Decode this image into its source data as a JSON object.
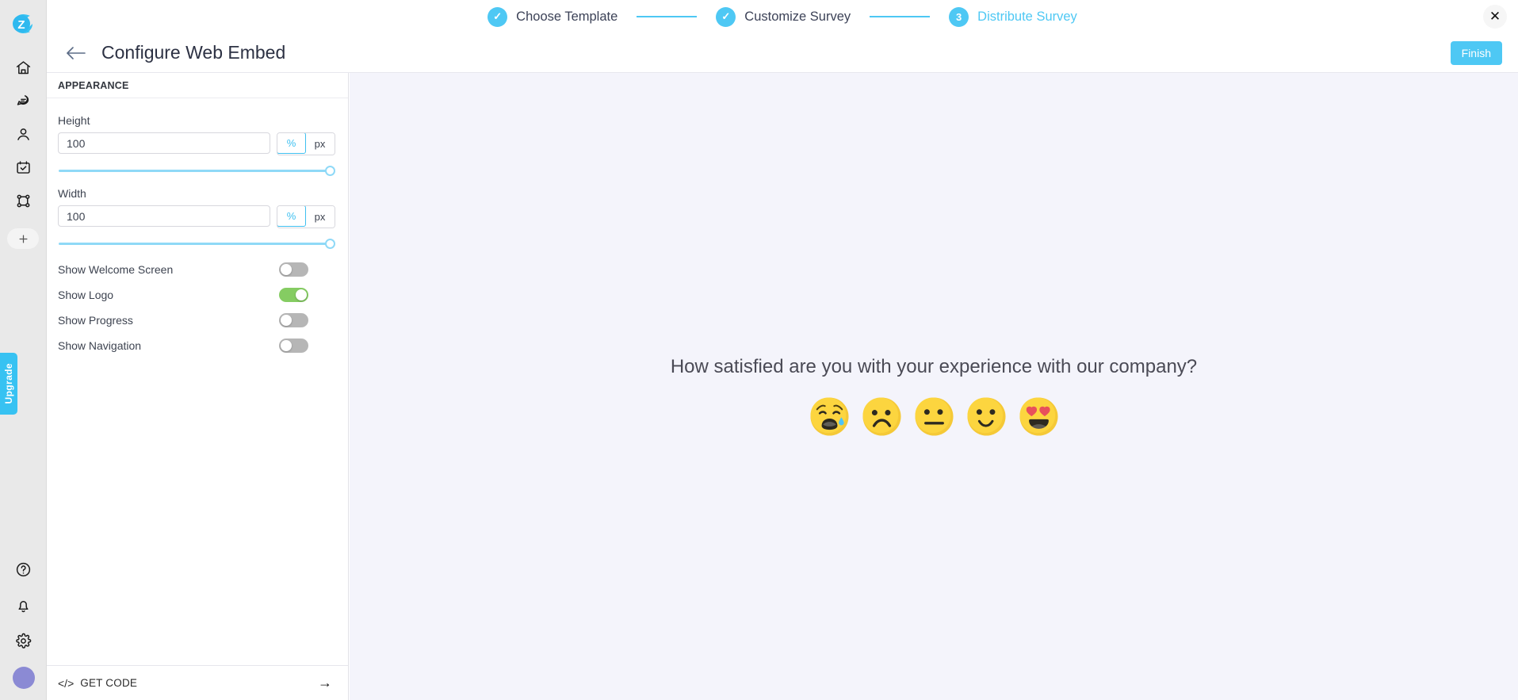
{
  "brand": {
    "accent": "#4ec8f4",
    "toggle_on": "#85cc62",
    "logo_letter": "Z",
    "upgrade_label": "Upgrade"
  },
  "sidebar": {
    "items": [
      {
        "name": "home-icon",
        "label": "Home"
      },
      {
        "name": "feedback-icon",
        "label": "Feedback"
      },
      {
        "name": "contacts-icon",
        "label": "Contacts"
      },
      {
        "name": "tasks-icon",
        "label": "Tasks"
      },
      {
        "name": "workflows-icon",
        "label": "Workflows"
      }
    ],
    "add_label": "+",
    "bottom_items": [
      {
        "name": "help-icon",
        "label": "Help"
      },
      {
        "name": "notifications-icon",
        "label": "Notifications"
      },
      {
        "name": "settings-icon",
        "label": "Settings"
      }
    ]
  },
  "stepper": {
    "steps": [
      {
        "badge": "✓",
        "label": "Choose Template",
        "state": "done"
      },
      {
        "badge": "✓",
        "label": "Customize Survey",
        "state": "done"
      },
      {
        "badge": "3",
        "label": "Distribute Survey",
        "state": "active"
      }
    ],
    "close_label": "✕"
  },
  "header": {
    "title": "Configure Web Embed",
    "back_label": "←",
    "finish_label": "Finish"
  },
  "panel": {
    "section_title": "APPEARANCE",
    "height": {
      "label": "Height",
      "value": "100",
      "units": [
        {
          "label": "%",
          "selected": true
        },
        {
          "label": "px",
          "selected": false
        }
      ],
      "slider_percent": 100
    },
    "width": {
      "label": "Width",
      "value": "100",
      "units": [
        {
          "label": "%",
          "selected": true
        },
        {
          "label": "px",
          "selected": false
        }
      ],
      "slider_percent": 100
    },
    "toggles": [
      {
        "label": "Show Welcome Screen",
        "on": false
      },
      {
        "label": "Show Logo",
        "on": true
      },
      {
        "label": "Show Progress",
        "on": false
      },
      {
        "label": "Show Navigation",
        "on": false
      }
    ],
    "get_code": {
      "label": "GET CODE",
      "glyph": "</>",
      "arrow": "→"
    }
  },
  "preview": {
    "question": "How satisfied are you with your experience with our company?",
    "emojis": [
      {
        "name": "crying-face-emoji",
        "rating": 1
      },
      {
        "name": "frowning-face-emoji",
        "rating": 2
      },
      {
        "name": "neutral-face-emoji",
        "rating": 3
      },
      {
        "name": "slightly-smiling-face-emoji",
        "rating": 4
      },
      {
        "name": "heart-eyes-face-emoji",
        "rating": 5
      }
    ]
  }
}
